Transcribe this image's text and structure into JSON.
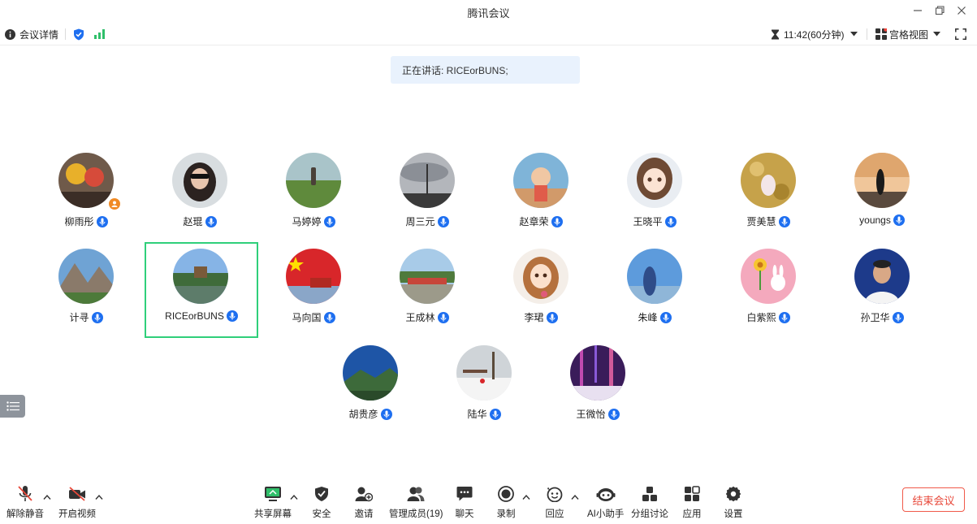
{
  "window": {
    "title": "腾讯会议"
  },
  "topbar": {
    "meeting_details": "会议详情",
    "timer": "11:42(60分钟)",
    "view_mode": "宫格视图"
  },
  "speaking": {
    "text": "正在讲话: RICEorBUNS;"
  },
  "participants": [
    {
      "name": "柳雨彤"
    },
    {
      "name": "赵琨"
    },
    {
      "name": "马婷婷"
    },
    {
      "name": "周三元"
    },
    {
      "name": "赵章荣"
    },
    {
      "name": "王晓平"
    },
    {
      "name": "贾美慧"
    },
    {
      "name": "youngs"
    },
    {
      "name": "计寻"
    },
    {
      "name": "RICEorBUNS"
    },
    {
      "name": "马向国"
    },
    {
      "name": "王成林"
    },
    {
      "name": "李珺"
    },
    {
      "name": "朱峰"
    },
    {
      "name": "白紫熙"
    },
    {
      "name": "孙卫华"
    },
    {
      "name": "胡贵彦"
    },
    {
      "name": "陆华"
    },
    {
      "name": "王微怡"
    }
  ],
  "toolbar": {
    "unmute": "解除静音",
    "start_video": "开启视频",
    "share_screen": "共享屏幕",
    "security": "安全",
    "invite": "邀请",
    "manage_members": "管理成员(19)",
    "chat": "聊天",
    "record": "录制",
    "reactions": "回应",
    "ai_assistant": "AI小助手",
    "breakout": "分组讨论",
    "apps": "应用",
    "settings": "设置",
    "end_meeting": "结束会议"
  },
  "colors": {
    "accent": "#1e6ff0",
    "active_border": "#2fcf7a",
    "end": "#e8483a"
  }
}
